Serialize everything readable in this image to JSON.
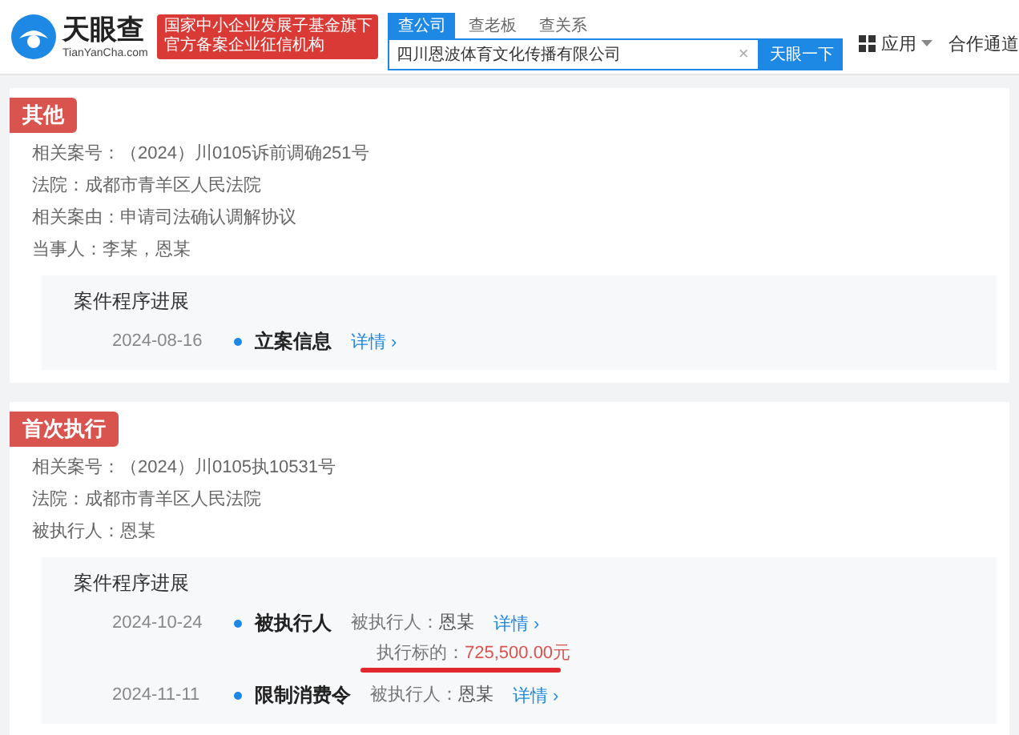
{
  "header": {
    "logo": {
      "name": "天眼查",
      "domain": "TianYanCha.com"
    },
    "badge": [
      "国家中小企业发展子基金旗下",
      "官方备案企业征信机构"
    ],
    "search_tabs": [
      {
        "label": "查公司",
        "selected": true
      },
      {
        "label": "查老板",
        "selected": false
      },
      {
        "label": "查关系",
        "selected": false
      }
    ],
    "search": {
      "value": "四川恩波体育文化传播有限公司",
      "clear": "×",
      "button": "天眼一下"
    },
    "nav": [
      {
        "kind": "menu",
        "label": "应用"
      },
      {
        "kind": "link",
        "label": "合作通道"
      }
    ]
  },
  "sections": [
    {
      "tag": "其他",
      "fields": [
        {
          "label": "相关案号：",
          "value": "（2024）川0105诉前调确251号"
        },
        {
          "label": "法院：",
          "value": "成都市青羊区人民法院"
        },
        {
          "label": "相关案由：",
          "value": "申请司法确认调解协议"
        },
        {
          "label": "当事人：",
          "value": "李某，恩某"
        }
      ],
      "progress": {
        "title": "案件程序进展",
        "entries": [
          {
            "date": "2024-08-16",
            "title": "立案信息",
            "link": "详情 ›"
          }
        ]
      }
    },
    {
      "tag": "首次执行",
      "fields": [
        {
          "label": "相关案号：",
          "value": "（2024）川0105执10531号"
        },
        {
          "label": "法院：",
          "value": "成都市青羊区人民法院"
        },
        {
          "label": "被执行人：",
          "value": "恩某"
        }
      ],
      "progress": {
        "title": "案件程序进展",
        "entries": [
          {
            "date": "2024-10-24",
            "title": "被执行人",
            "details": [
              {
                "label": "被执行人：",
                "value": "恩某",
                "kind": "plain"
              },
              {
                "label": "执行标的：",
                "value": "725,500.00元",
                "kind": "amount",
                "underlined": true
              }
            ],
            "link": "详情 ›"
          },
          {
            "date": "2024-11-11",
            "title": "限制消费令",
            "details": [
              {
                "label": "被执行人：",
                "value": "恩某",
                "kind": "plain"
              }
            ],
            "link": "详情 ›"
          }
        ]
      }
    }
  ]
}
